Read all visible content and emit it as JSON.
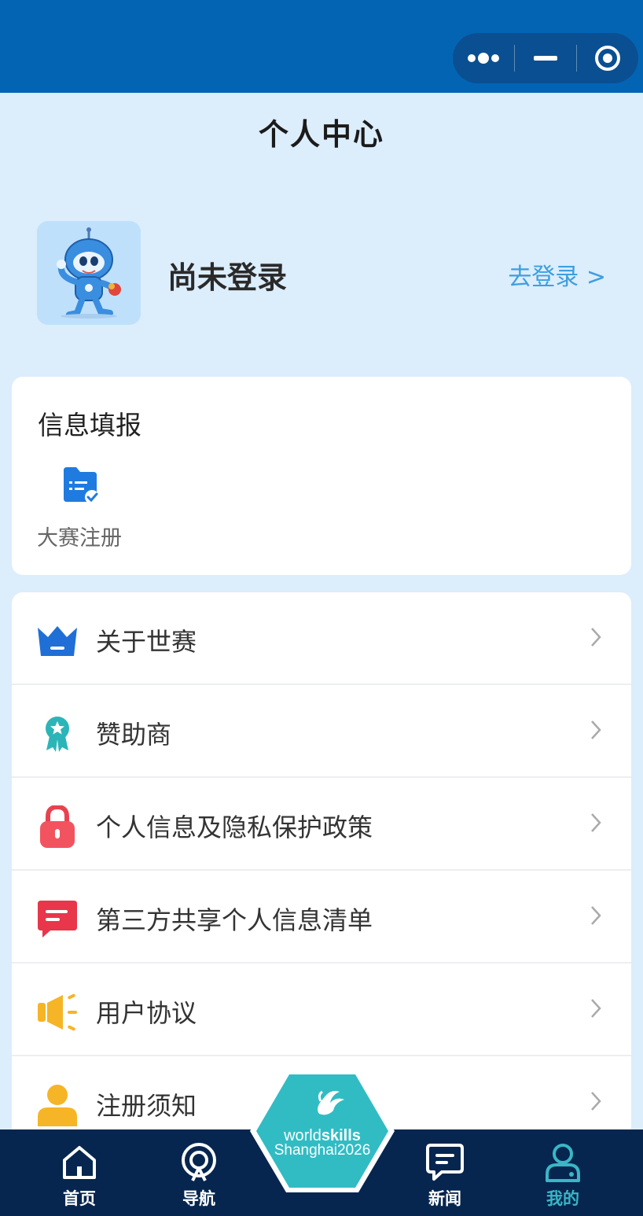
{
  "header": {
    "title": "个人中心",
    "capsule": {
      "more_icon": "more-dots-icon",
      "minimize_icon": "minimize-icon",
      "close_icon": "target-icon"
    }
  },
  "profile": {
    "status": "尚未登录",
    "login_link": "去登录 >",
    "avatar_icon": "mascot-avatar"
  },
  "info_card": {
    "title": "信息填报",
    "items": [
      {
        "label": "大赛注册",
        "icon": "folder-check-icon"
      }
    ]
  },
  "menu": {
    "items": [
      {
        "label": "关于世赛",
        "icon": "crown-icon"
      },
      {
        "label": "赞助商",
        "icon": "award-ribbon-icon"
      },
      {
        "label": "个人信息及隐私保护政策",
        "icon": "lock-icon"
      },
      {
        "label": "第三方共享个人信息清单",
        "icon": "message-list-icon"
      },
      {
        "label": "用户协议",
        "icon": "megaphone-icon"
      },
      {
        "label": "注册须知",
        "icon": "user-icon"
      }
    ]
  },
  "tabbar": {
    "items": [
      {
        "label": "首页",
        "icon": "home-icon"
      },
      {
        "label": "导航",
        "icon": "location-pin-icon"
      },
      {
        "label": "新闻",
        "icon": "news-chat-icon"
      },
      {
        "label": "我的",
        "icon": "profile-icon",
        "active": true
      }
    ],
    "logo": {
      "line1_a": "world",
      "line1_b": "skills",
      "line2": "Shanghai2026"
    }
  },
  "colors": {
    "status_bar": "#0464b4",
    "page_bg": "#dcedfc",
    "link": "#3d9fe0",
    "tabbar_bg": "#06264f",
    "accent_teal": "#3ab6c6"
  }
}
